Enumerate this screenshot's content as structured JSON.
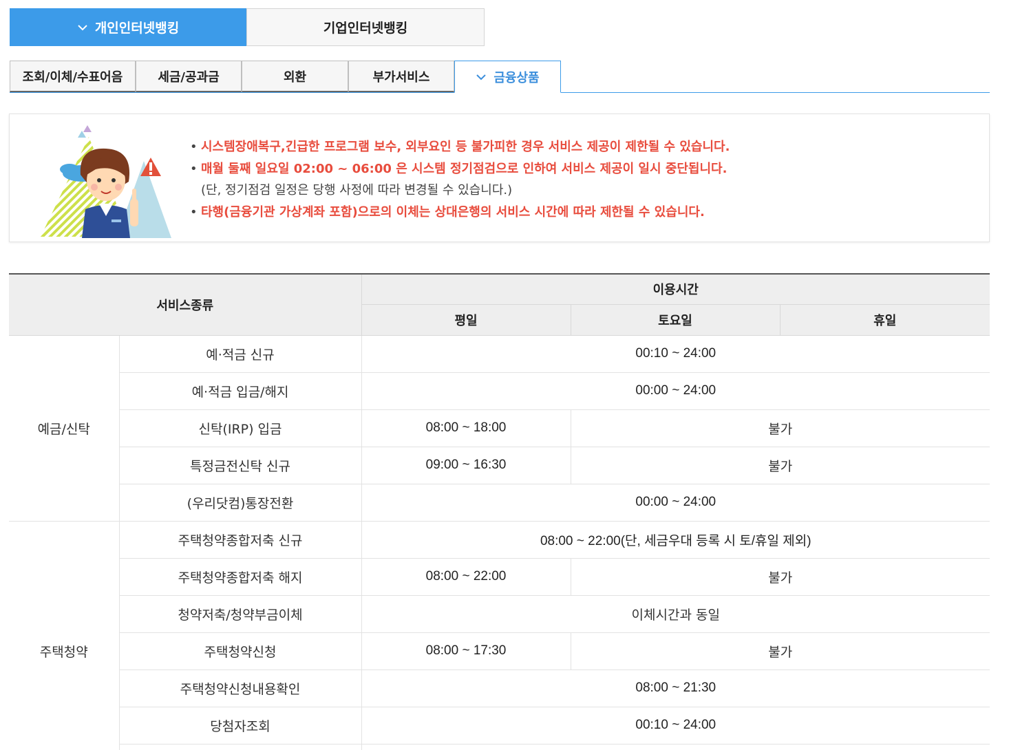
{
  "top_tabs": {
    "personal": "개인인터넷뱅킹",
    "corporate": "기업인터넷뱅킹"
  },
  "sub_tabs": [
    "조회/이체/수표어음",
    "세금/공과금",
    "외환",
    "부가서비스",
    "금융상품"
  ],
  "notice": {
    "line1": "시스템장애복구,긴급한 프로그램 보수, 외부요인 등 불가피한 경우 서비스 제공이 제한될 수 있습니다.",
    "line2": "매월 둘째 일요일 02:00 ~ 06:00 은 시스템 정기점검으로 인하여 서비스 제공이 일시 중단됩니다.",
    "line2_sub": "(단, 정기점검 일정은 당행 사정에 따라 변경될 수 있습니다.)",
    "line3": "타행(금융기관 가상계좌 포함)으로의 이체는 상대은행의 서비스 시간에 따라 제한될 수 있습니다."
  },
  "table": {
    "header_service": "서비스종류",
    "header_time": "이용시간",
    "header_weekday": "평일",
    "header_saturday": "토요일",
    "header_holiday": "휴일",
    "group1": "예금/신탁",
    "group2": "주택청약",
    "rows": {
      "r1": {
        "name": "예·적금 신규",
        "all": "00:10 ~ 24:00"
      },
      "r2": {
        "name": "예·적금 입금/해지",
        "all": "00:00 ~ 24:00"
      },
      "r3": {
        "name": "신탁(IRP) 입금",
        "weekday": "08:00 ~ 18:00",
        "rest": "불가"
      },
      "r4": {
        "name": "특정금전신탁 신규",
        "weekday": "09:00 ~ 16:30",
        "rest": "불가"
      },
      "r5": {
        "name": "(우리닷컴)통장전환",
        "all": "00:00 ~ 24:00"
      },
      "r6": {
        "name": "주택청약종합저축 신규",
        "all": "08:00 ~ 22:00(단, 세금우대 등록 시 토/휴일 제외)"
      },
      "r7": {
        "name": "주택청약종합저축 해지",
        "weekday": "08:00 ~ 22:00",
        "rest": "불가"
      },
      "r8": {
        "name": "청약저축/청약부금이체",
        "all": "이체시간과 동일"
      },
      "r9": {
        "name": "주택청약신청",
        "weekday": "08:00 ~ 17:30",
        "rest": "불가"
      },
      "r10": {
        "name": "주택청약신청내용확인",
        "all": "08:00 ~ 21:30"
      },
      "r11": {
        "name": "당첨자조회",
        "all": "00:10 ~ 24:00"
      }
    }
  },
  "colors": {
    "accent": "#3c9be9",
    "warning_text": "#e84c3d",
    "header_bg": "#eeeeee"
  }
}
